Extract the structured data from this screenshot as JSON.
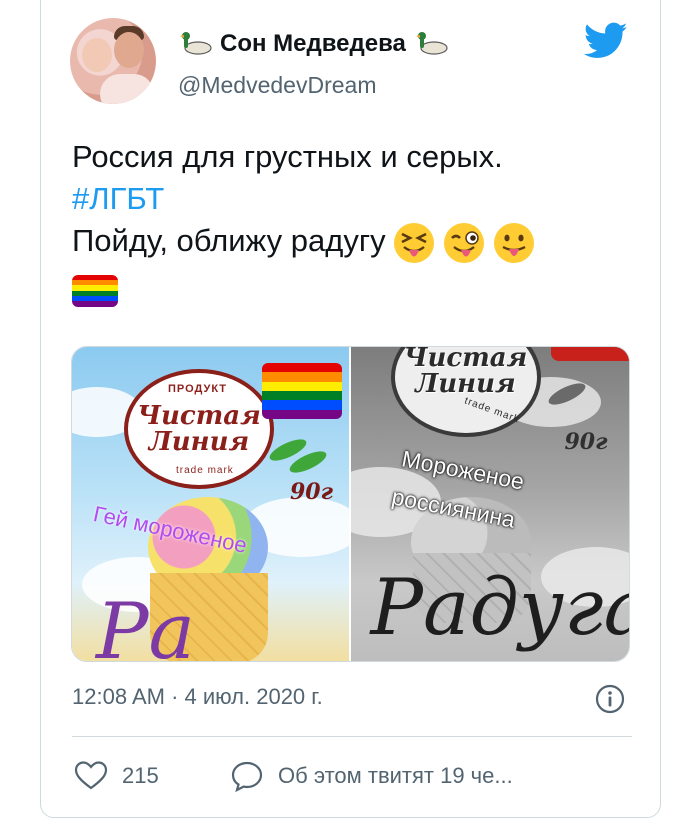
{
  "tweet": {
    "display_name": "Сон Медведева",
    "handle": "@MedvedevDream",
    "text_line1": "Россия для грустных и серых.",
    "hashtag": "#ЛГБТ",
    "text_line3": "Пойду, оближу радугу",
    "emojis": [
      "squinting-tongue-emoji",
      "winking-tongue-emoji",
      "tongue-out-emoji"
    ],
    "timestamp": "12:08 AM · 4 июл. 2020 г.",
    "likes": "215",
    "replies_label": "Об этом твитят 19 че..."
  },
  "media": {
    "left": {
      "brand_top": "ПРОДУКТ",
      "brand_line1": "Чистая",
      "brand_line2": "Линия",
      "brand_sub": "trade mark",
      "weight": "90г",
      "overlay_caption": "Гей мороженое",
      "product_script": "Ра"
    },
    "right": {
      "brand_line1": "Чистая",
      "brand_line2": "Линия",
      "brand_sub": "trade mark",
      "weight": "90г",
      "overlay_line1": "Мороженое",
      "overlay_line2": "россиянина",
      "product_script": "Радуга"
    }
  },
  "colors": {
    "accent": "#1d9bf0",
    "text": "#0f1419",
    "secondary": "#536471",
    "border": "#cfd9de",
    "rainbow": [
      "#e40303",
      "#ff8c00",
      "#ffed00",
      "#008026",
      "#004dff",
      "#750787"
    ]
  }
}
